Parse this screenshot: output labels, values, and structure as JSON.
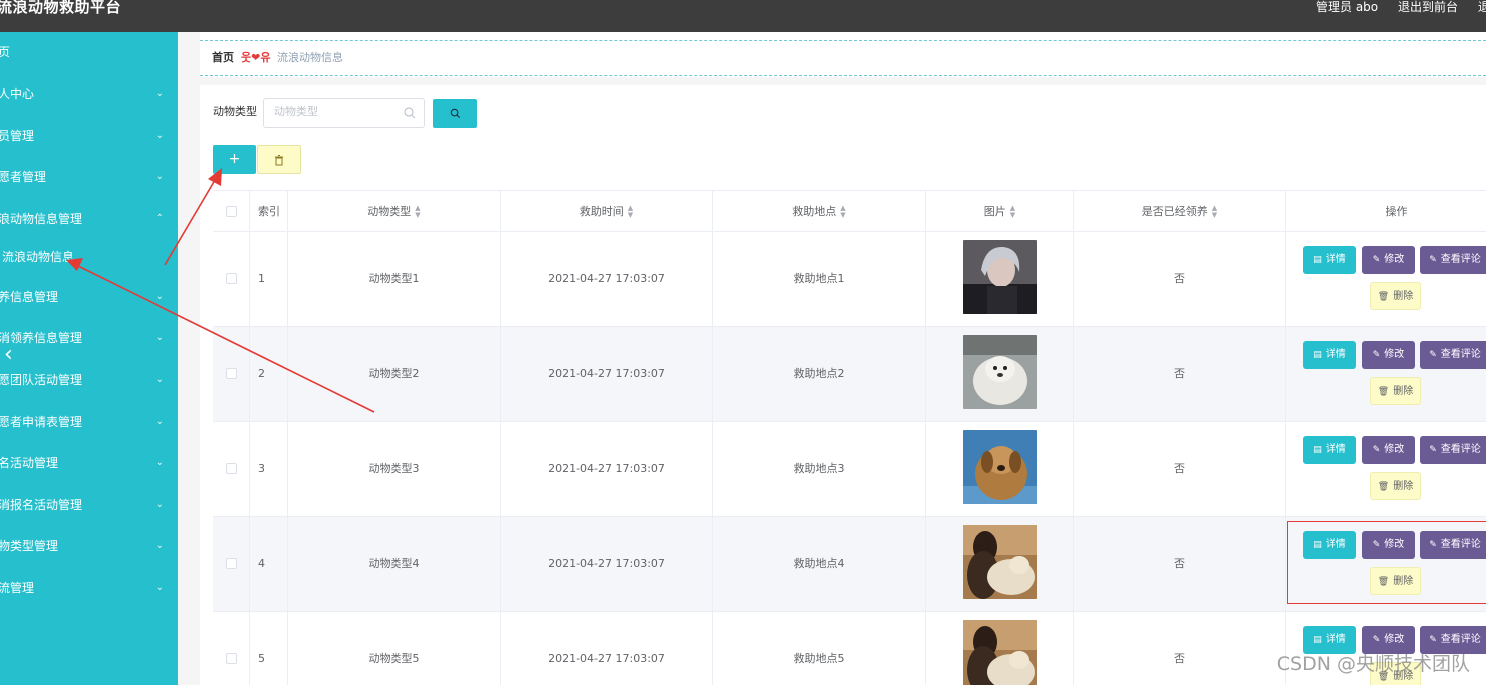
{
  "header": {
    "app_title": "流浪动物救助平台",
    "admin_label": "管理员 abo",
    "front_link": "退出到前台",
    "logout_link": "退出"
  },
  "sidebar": {
    "items": [
      {
        "label": "页",
        "chevron": false
      },
      {
        "label": "人中心",
        "chevron": true
      },
      {
        "label": "员管理",
        "chevron": true
      },
      {
        "label": "愿者管理",
        "chevron": true
      },
      {
        "label": "浪动物信息管理",
        "chevron": true,
        "expanded": true
      },
      {
        "label": "流浪动物信息",
        "chevron": false,
        "sub": true,
        "active": true
      },
      {
        "label": "养信息管理",
        "chevron": true
      },
      {
        "label": "消领养信息管理",
        "chevron": true
      },
      {
        "label": "愿团队活动管理",
        "chevron": true
      },
      {
        "label": "愿者申请表管理",
        "chevron": true
      },
      {
        "label": "名活动管理",
        "chevron": true
      },
      {
        "label": "消报名活动管理",
        "chevron": true
      },
      {
        "label": "物类型管理",
        "chevron": true
      },
      {
        "label": "流管理",
        "chevron": true
      }
    ],
    "collapse_icon": "chevron-left-icon"
  },
  "breadcrumb": {
    "home": "首页",
    "heart": "웃❤유",
    "current": "流浪动物信息"
  },
  "search": {
    "label": "动物类型",
    "placeholder": "动物类型",
    "value": ""
  },
  "toolbar": {
    "add_label": "+",
    "delete_icon": "trash-icon"
  },
  "table": {
    "columns": [
      "索引",
      "动物类型",
      "救助时间",
      "救助地点",
      "图片",
      "是否已经领养",
      "操作"
    ],
    "sortable": [
      false,
      true,
      true,
      true,
      true,
      true,
      false
    ],
    "rows": [
      {
        "index": "1",
        "type": "动物类型1",
        "time": "2021-04-27 17:03:07",
        "place": "救助地点1",
        "adopted": "否",
        "image": "gray-haired-man"
      },
      {
        "index": "2",
        "type": "动物类型2",
        "time": "2021-04-27 17:03:07",
        "place": "救助地点2",
        "adopted": "否",
        "image": "white-dog"
      },
      {
        "index": "3",
        "type": "动物类型3",
        "time": "2021-04-27 17:03:07",
        "place": "救助地点3",
        "adopted": "否",
        "image": "brown-puppy"
      },
      {
        "index": "4",
        "type": "动物类型4",
        "time": "2021-04-27 17:03:07",
        "place": "救助地点4",
        "adopted": "否",
        "image": "person-with-dog"
      },
      {
        "index": "5",
        "type": "动物类型5",
        "time": "2021-04-27 17:03:07",
        "place": "救助地点5",
        "adopted": "否",
        "image": "person-with-dog"
      }
    ],
    "actions": {
      "detail": "详情",
      "edit": "修改",
      "comment": "查看评论",
      "delete": "删除"
    }
  },
  "colors": {
    "accent": "#26bfcd",
    "header_bg": "#3d3d3d",
    "purple_button": "#6b5b95",
    "yellow_button": "#fdfbc7",
    "annotation_red": "#e53935"
  },
  "watermark": "CSDN @央顺技术团队"
}
